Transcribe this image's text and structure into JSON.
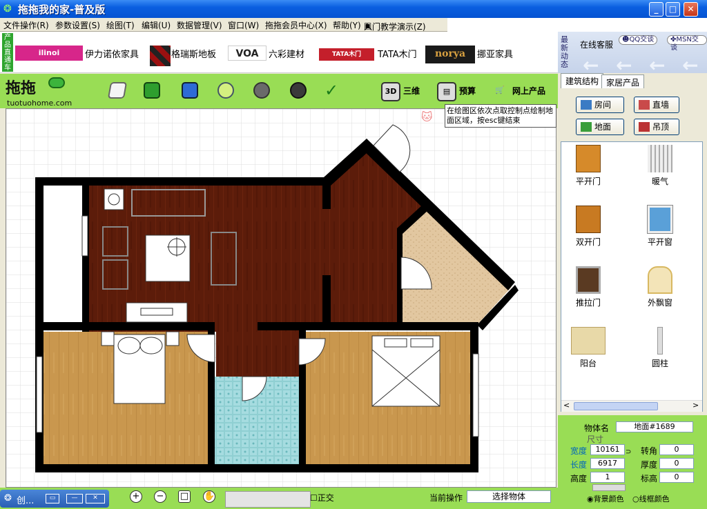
{
  "window": {
    "title": "拖拖我的家-普及版",
    "min": "_",
    "max": "□",
    "close": "✕"
  },
  "menu": [
    "文件操作(R)",
    "参数设置(S)",
    "绘图(T)",
    "编辑(U)",
    "数据管理(V)",
    "窗口(W)",
    "拖拖会员中心(X)",
    "帮助(Y)",
    "入门教学演示(Z)"
  ],
  "ads": {
    "tag": "产品直通车",
    "brands": [
      {
        "logo": "ilinoi",
        "name": "伊力诺依家具"
      },
      {
        "logo": "",
        "name": "格瑞斯地板"
      },
      {
        "logo": "VOA",
        "name": "六彩建材"
      },
      {
        "logo": "TATA木门",
        "name": "TATA木门"
      },
      {
        "logo": "norya",
        "name": "挪亚家具"
      }
    ],
    "news": "最新动态",
    "service": "在线客服",
    "qq": "QQ交谈",
    "msn": "MSN交谈"
  },
  "toolbar": {
    "logo": "拖拖",
    "site": "tuotuohome.com",
    "three_d": "三维",
    "three_d_icon": "3D",
    "budget": "预算",
    "online": "网上产品"
  },
  "hint": "在绘图区依次点取控制点绘制地面区域，按esc键结束",
  "panel": {
    "tabs": [
      "建筑结构",
      "家居产品"
    ],
    "buttons": [
      "房间",
      "直墙",
      "地面",
      "吊顶"
    ],
    "items": [
      "平开门",
      "暖气",
      "双开门",
      "平开窗",
      "推拉门",
      "外飘窗",
      "阳台",
      "圆柱"
    ]
  },
  "props": {
    "name_label": "物体名",
    "name_value": "地面#1689",
    "size_label": "尺寸",
    "width_label": "宽度",
    "width_value": "10161",
    "angle_label": "转角",
    "angle_value": "0",
    "length_label": "长度",
    "length_value": "6917",
    "thick_label": "厚度",
    "thick_value": "0",
    "height_label": "高度",
    "height_value": "1",
    "elev_label": "标高",
    "elev_value": "0",
    "bg_color": "背景颜色",
    "frame_color": "线框颜色"
  },
  "status": {
    "ortho": "正交",
    "op_label": "当前操作",
    "op_value": "选择物体",
    "task": "创..."
  },
  "colors": {
    "accent_green": "#99dd55",
    "wood_dark": "#5a1a08",
    "wood_light": "#c8964c",
    "tile": "#8fd0d4",
    "floor_beige": "#e0c49a"
  }
}
